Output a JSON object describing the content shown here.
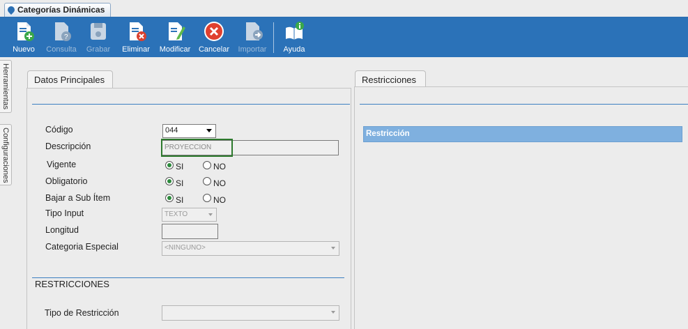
{
  "window": {
    "tab_title": "Categorías Dinámicas"
  },
  "toolbar": {
    "nuevo": "Nuevo",
    "consulta": "Consulta",
    "grabar": "Grabar",
    "eliminar": "Eliminar",
    "modificar": "Modificar",
    "cancelar": "Cancelar",
    "importar": "Importar",
    "ayuda": "Ayuda"
  },
  "side_tabs": {
    "herramientas": "Herramientas",
    "configuraciones": "Configuraciones"
  },
  "datos": {
    "tab": "Datos Principales",
    "codigo_label": "Código",
    "codigo_value": "044",
    "descripcion_label": "Descripción",
    "descripcion_value": "PROYECCION",
    "vigente_label": "Vigente",
    "obligatorio_label": "Obligatorio",
    "bajar_label": "Bajar a Sub Ítem",
    "si": "SI",
    "no": "NO",
    "tipo_input_label": "Tipo Input",
    "tipo_input_value": "TEXTO",
    "longitud_label": "Longitud",
    "categoria_label": "Categoria Especial",
    "categoria_value": "<NINGUNO>",
    "restricciones_title": "RESTRICCIONES",
    "tipo_restriccion_label": "Tipo de Restricción"
  },
  "restricciones": {
    "tab": "Restricciones",
    "column_header": "Restricción"
  },
  "colors": {
    "toolbar": "#2b72b8",
    "accent": "#3b7fc1",
    "highlight": "#2d7a2d",
    "grid_header": "#7fb0df"
  }
}
